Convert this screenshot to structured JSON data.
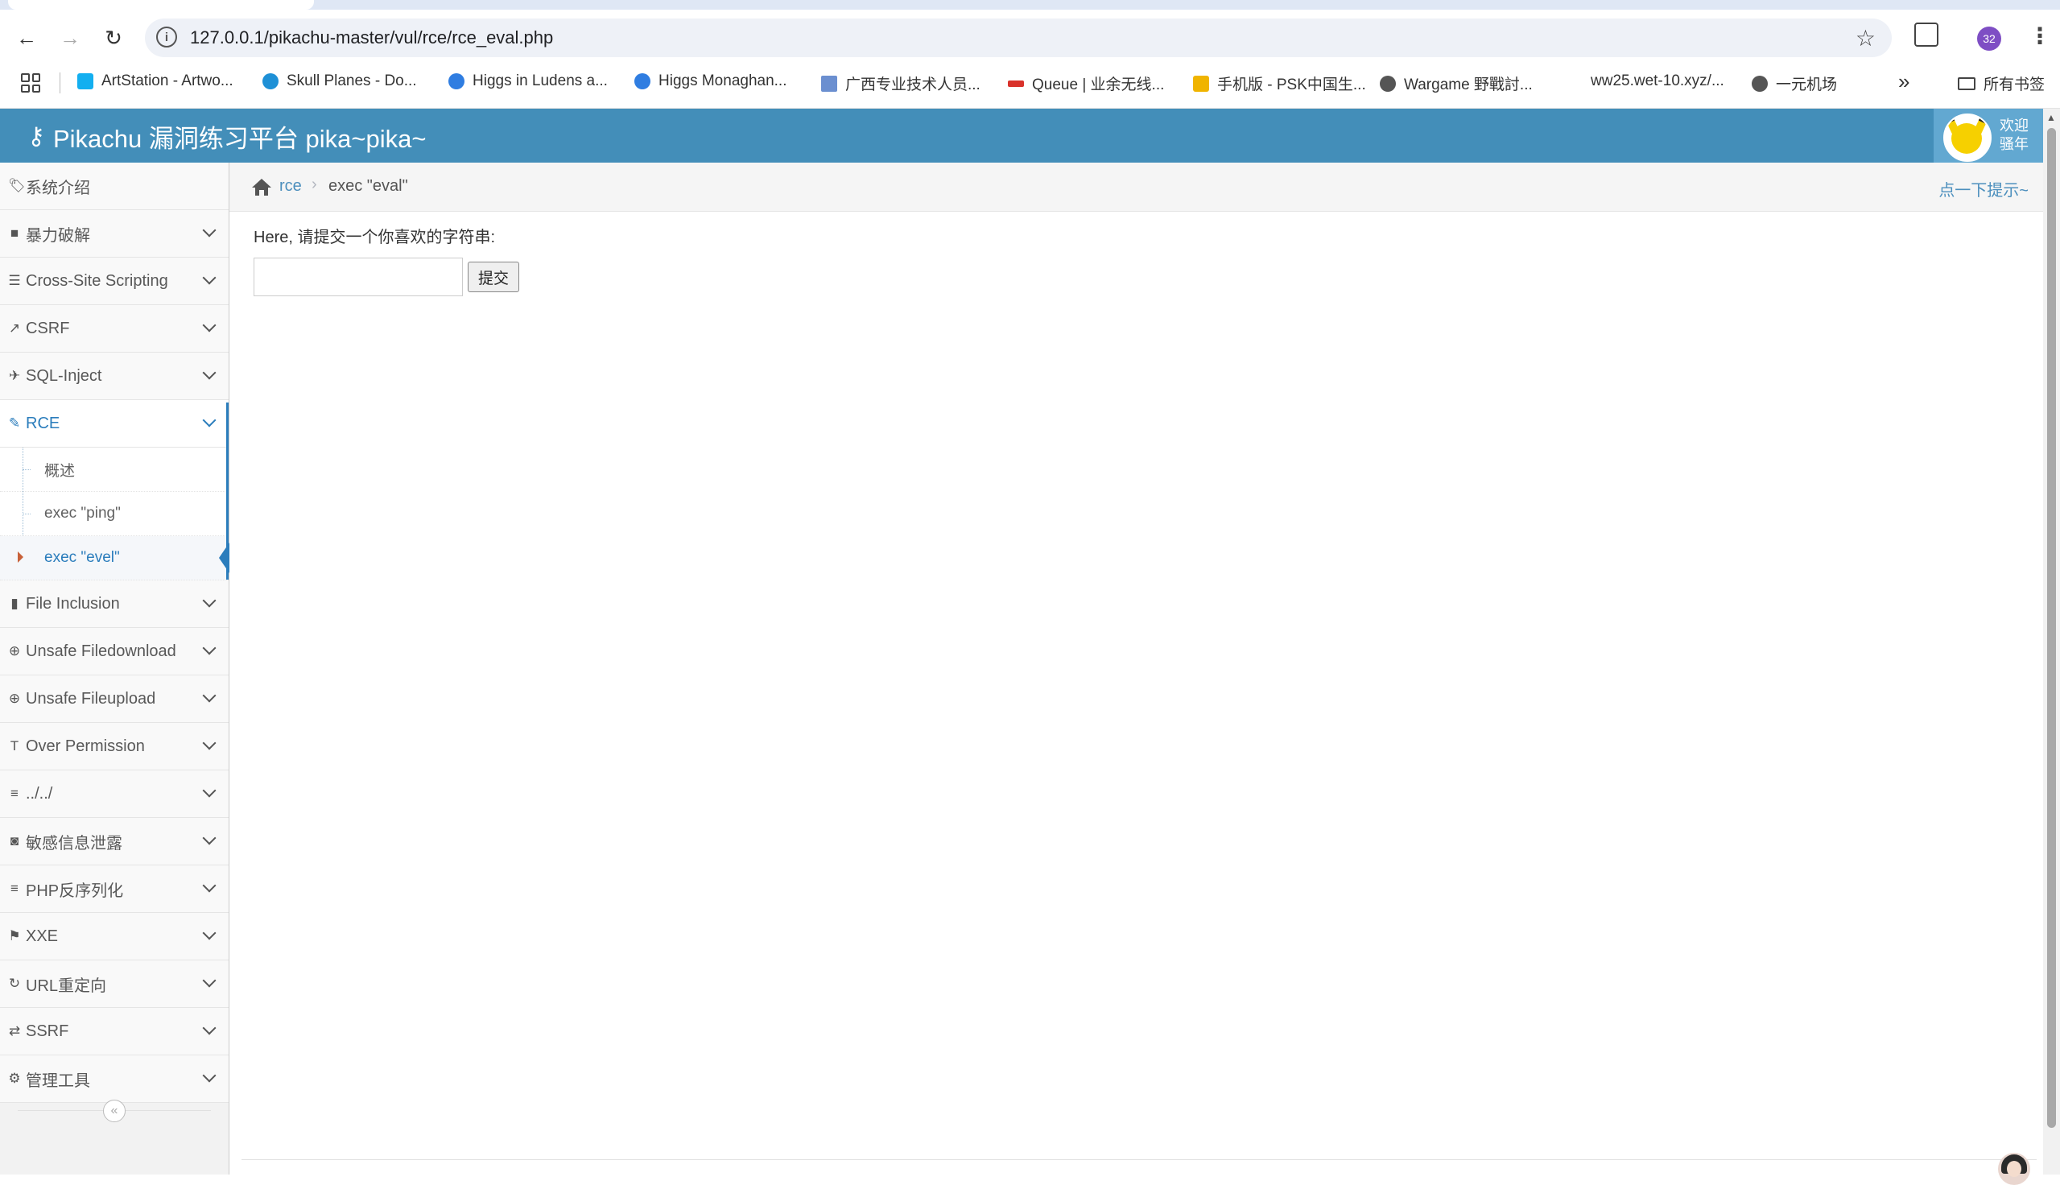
{
  "browser": {
    "url": "127.0.0.1/pikachu-master/vul/rce/rce_eval.php",
    "profile_badge": "32",
    "bookmarks": [
      {
        "label": "ArtStation - Artwo...",
        "color": "#13aff0"
      },
      {
        "label": "Skull Planes - Do...",
        "color": "#1e90d6"
      },
      {
        "label": "Higgs in Ludens a...",
        "color": "#2f7de1"
      },
      {
        "label": "Higgs Monaghan...",
        "color": "#2f7de1"
      },
      {
        "label": "广西专业技术人员...",
        "color": "#6b8fd0"
      },
      {
        "label": "Queue | 业余无线...",
        "color": "#d9322b"
      },
      {
        "label": "手机版 - PSK中国生...",
        "color": "#f0b400"
      },
      {
        "label": "Wargame 野戰討...",
        "color": "#555555"
      },
      {
        "label": "ww25.wet-10.xyz/...",
        "color": "#ffffff"
      },
      {
        "label": "一元机场",
        "color": "#555555"
      }
    ],
    "bookmarks_folder": "所有书签"
  },
  "header": {
    "title": "Pikachu 漏洞练习平台 pika~pika~",
    "welcome_line1": "欢迎",
    "welcome_line2": "骚年"
  },
  "sidebar": {
    "items": [
      {
        "label": "系统介绍",
        "icon": "tags-icon",
        "glyph": "🏷"
      },
      {
        "label": "暴力破解",
        "icon": "lock-icon",
        "glyph": "🔒"
      },
      {
        "label": "Cross-Site Scripting",
        "icon": "list-icon",
        "glyph": "☰"
      },
      {
        "label": "CSRF",
        "icon": "external-link-icon",
        "glyph": "↗"
      },
      {
        "label": "SQL-Inject",
        "icon": "fighter-jet-icon",
        "glyph": "✈"
      },
      {
        "label": "RCE",
        "icon": "pencil-icon",
        "glyph": "✎"
      },
      {
        "label": "File Inclusion",
        "icon": "file-icon",
        "glyph": "▮"
      },
      {
        "label": "Unsafe Filedownload",
        "icon": "download-icon",
        "glyph": "⊕"
      },
      {
        "label": "Unsafe Fileupload",
        "icon": "upload-icon",
        "glyph": "⊕"
      },
      {
        "label": "Over Permission",
        "icon": "text-height-icon",
        "glyph": "T"
      },
      {
        "label": "../../",
        "icon": "align-left-icon",
        "glyph": "≡"
      },
      {
        "label": "敏感信息泄露",
        "icon": "camera-icon",
        "glyph": "◙"
      },
      {
        "label": "PHP反序列化",
        "icon": "align-justify-icon",
        "glyph": "≡"
      },
      {
        "label": "XXE",
        "icon": "flag-icon",
        "glyph": "⚑"
      },
      {
        "label": "URL重定向",
        "icon": "refresh-icon",
        "glyph": "↻"
      },
      {
        "label": "SSRF",
        "icon": "exchange-icon",
        "glyph": "⇄"
      },
      {
        "label": "管理工具",
        "icon": "cog-icon",
        "glyph": "⚙"
      }
    ],
    "rce_submenu": [
      "概述",
      "exec \"ping\"",
      "exec \"evel\""
    ]
  },
  "breadcrumb": {
    "section": "rce",
    "current": "exec \"eval\"",
    "tips": "点一下提示~"
  },
  "main": {
    "prompt": "Here, 请提交一个你喜欢的字符串:",
    "input_value": "",
    "submit_label": "提交"
  }
}
